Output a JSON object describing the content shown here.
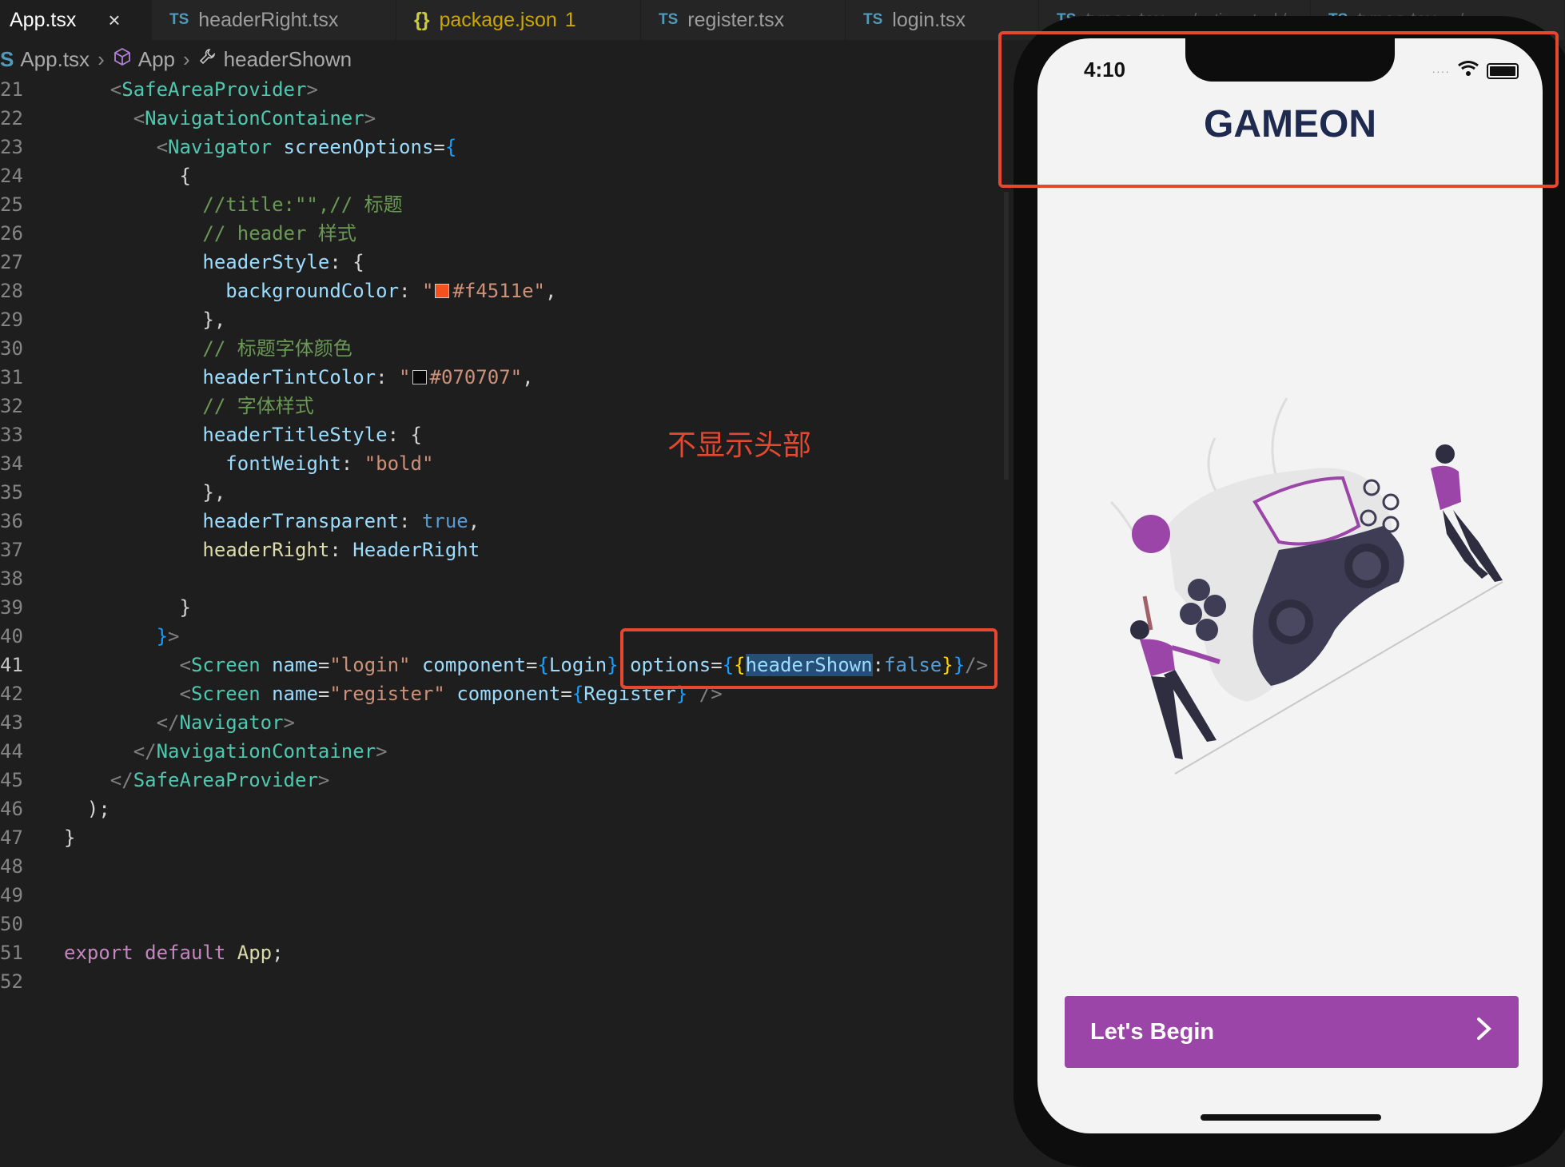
{
  "editor": {
    "tabs": [
      {
        "label": "App.tsx",
        "icon": "",
        "close": "×"
      },
      {
        "label": "headerRight.tsx",
        "icon": "TS"
      },
      {
        "label": "package.json",
        "icon": "{}",
        "modified": "1"
      },
      {
        "label": "register.tsx",
        "icon": "TS"
      },
      {
        "label": "login.tsx",
        "icon": "TS"
      },
      {
        "label": "types.tsx",
        "icon": "TS",
        "path": ".../native-stack/"
      },
      {
        "label": "types.tsx",
        "icon": "TS",
        "path": ".../c"
      }
    ],
    "breadcrumb": {
      "file": "App.tsx",
      "component": "App",
      "symbol": "headerShown",
      "file_icon": "S"
    },
    "line_numbers": [
      "21",
      "22",
      "23",
      "24",
      "25",
      "26",
      "27",
      "28",
      "29",
      "30",
      "31",
      "32",
      "33",
      "34",
      "35",
      "36",
      "37",
      "38",
      "39",
      "40",
      "41",
      "42",
      "43",
      "44",
      "45",
      "46",
      "47",
      "48",
      "49",
      "50",
      "51",
      "52"
    ],
    "annotation": "不显示头部"
  },
  "phone": {
    "time": "4:10",
    "title": "GAMEON",
    "button_label": "Let's Begin",
    "button_arrow": "›"
  },
  "colors": {
    "accent_red": "#e5472f",
    "button_purple": "#9a45a7",
    "title_navy": "#1e2a4f",
    "swatch_orange": "#f4511e",
    "swatch_dark": "#070707"
  }
}
